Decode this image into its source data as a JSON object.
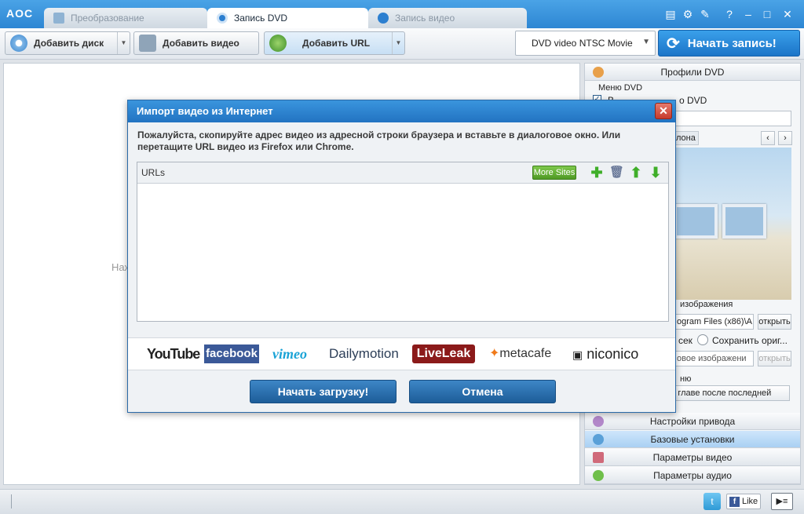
{
  "app": {
    "logo": "AOC"
  },
  "tabs": [
    {
      "label": "Преобразование"
    },
    {
      "label": "Запись DVD"
    },
    {
      "label": "Запись видео"
    }
  ],
  "window_icons": [
    "menu-icon",
    "gear-icon",
    "wrench-icon",
    "help-icon",
    "minimize-icon",
    "maximize-icon",
    "close-icon"
  ],
  "window_glyphs": {
    "menu": "▤",
    "gear": "⚙",
    "wrench": "✎",
    "help": "?",
    "minimize": "–",
    "maximize": "□",
    "close": "✕"
  },
  "toolbar": {
    "add_disc": "Добавить диск",
    "add_video": "Добавить видео",
    "add_url": "Добавить URL",
    "format_value": "DVD video NTSC Movie",
    "start_record": "Начать запись!"
  },
  "main": {
    "hint_partial": "Наж"
  },
  "right_panel": {
    "dvd_profiles": "Профили DVD",
    "dvd_menu_group": "Меню DVD",
    "dvd_menu_check_label_partial": "В",
    "dvd_menu_check_label_end": "о DVD",
    "template_tab_partial": "лона",
    "image_group_partial": "изображения",
    "path_field_partial": "ogram Files (x86)\\A",
    "open_btn": "открыть",
    "sec_partial": "сек",
    "keep_original_partial": "Сохранить ориг...",
    "new_image_partial": "овое изображени",
    "open_btn_disabled": "открыть",
    "chapter_group_partial": "ню",
    "chapter_value_partial": "ой главе после последней",
    "drive_settings": "Настройки привода",
    "basic_settings": "Базовые установки",
    "video_params": "Параметры видео",
    "audio_params": "Параметры аудио"
  },
  "status": {
    "like": "Like"
  },
  "dialog": {
    "title": "Импорт видео из Интернет",
    "message": "Пожалуйста, скопируйте адрес видео из адресной строки браузера и вставьте в диалоговое окно. Или перетащите URL видео из Firefox или Chrome.",
    "urls_header": "URLs",
    "more_sites": "More Sites",
    "logos": [
      "YouTube",
      "facebook",
      "vimeo",
      "Dailymotion",
      "LiveLeak",
      "metacafe",
      "niconico"
    ],
    "start_download": "Начать загрузку!",
    "cancel": "Отмена"
  },
  "colors": {
    "accent": "#2d86d3",
    "start_btn": "#1b74c8",
    "selected_panel": "#a9d0f3",
    "dialog_button": "#1d5d99"
  }
}
